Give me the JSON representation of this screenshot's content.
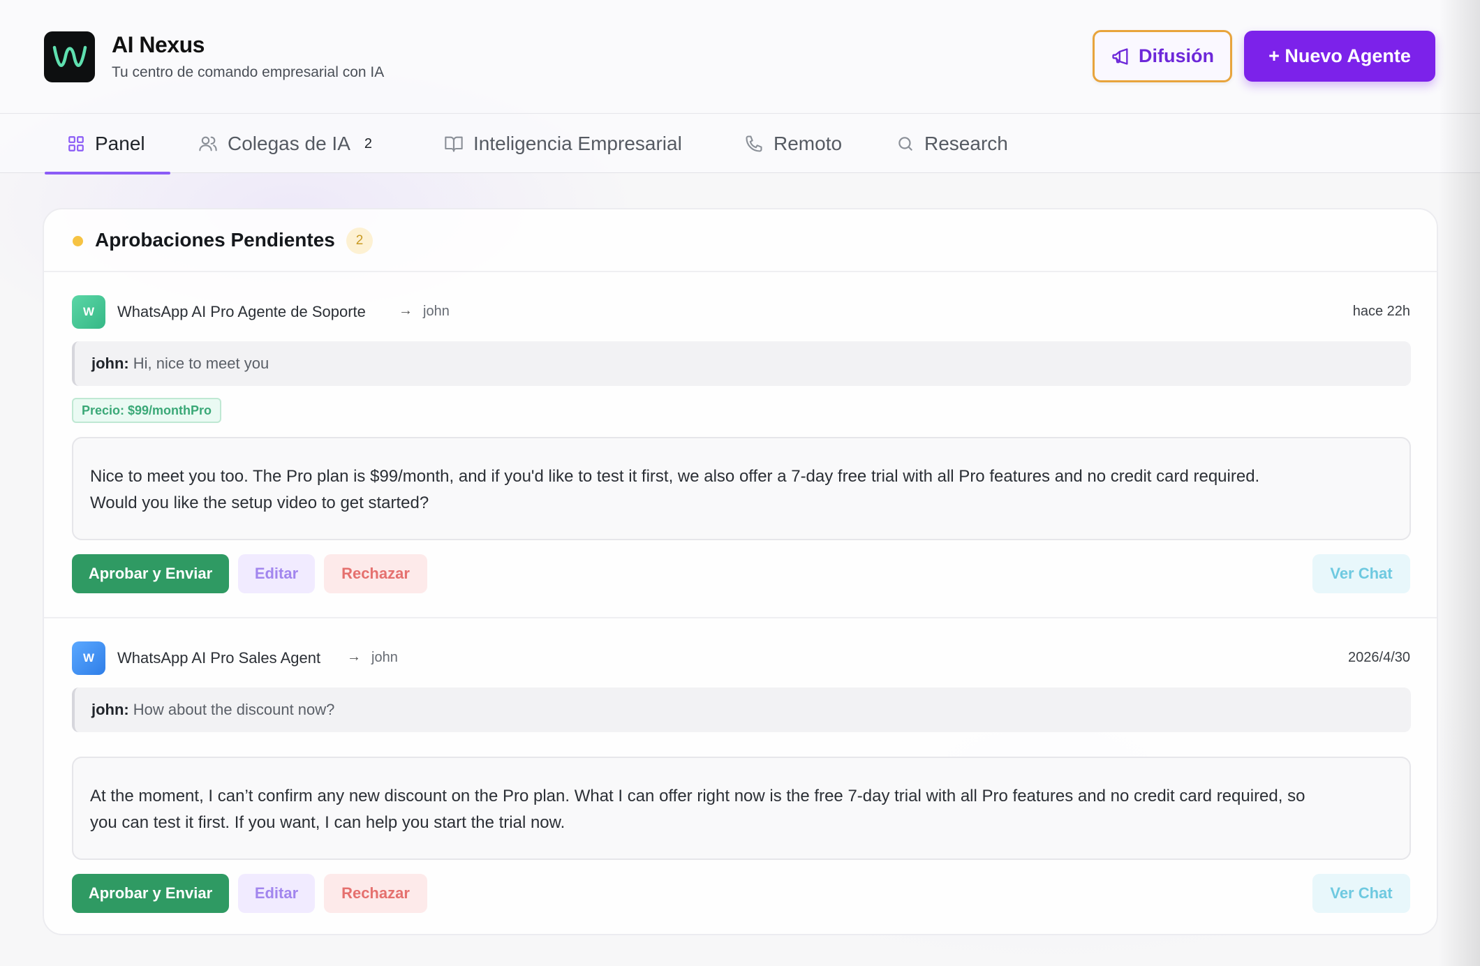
{
  "app": {
    "title": "AI Nexus",
    "subtitle": "Tu centro de comando empresarial con IA",
    "logo_icon": "w-wave-logo"
  },
  "header_actions": {
    "broadcast_label": "Difusión",
    "broadcast_icon": "megaphone-icon",
    "new_agent_label": "+ Nuevo Agente"
  },
  "tabs": [
    {
      "label": "Panel",
      "icon": "grid-icon",
      "active": true
    },
    {
      "label": "Colegas de IA",
      "icon": "users-icon",
      "badge": "2"
    },
    {
      "label": "Inteligencia Empresarial",
      "icon": "book-icon"
    },
    {
      "label": "Remoto",
      "icon": "phone-icon"
    },
    {
      "label": "Research",
      "icon": "search-icon"
    }
  ],
  "pending": {
    "title": "Aprobaciones Pendientes",
    "count": "2",
    "items": [
      {
        "avatar_letter": "W",
        "avatar_color": "#3fc596",
        "agent": "WhatsApp AI Pro Agente de Soporte",
        "arrow": "→",
        "recipient": "john",
        "time": "hace 22h",
        "incoming_sender": "john:",
        "incoming_text": "Hi, nice to meet you",
        "price_tag": "Precio: $99/monthPro",
        "reply_line1": "Nice to meet you too. The Pro plan is $99/month, and if you'd like to test it first, we also offer a 7-day free trial with all Pro features and no credit card required.",
        "reply_line2": "Would you like the setup video to get started?",
        "approve": "Aprobar y Enviar",
        "edit": "Editar",
        "reject": "Rechazar",
        "view_chat": "Ver Chat"
      },
      {
        "avatar_letter": "W",
        "avatar_color": "#3b8df0",
        "agent": "WhatsApp AI Pro Sales Agent",
        "arrow": "→",
        "recipient": "john",
        "time": "2026/4/30",
        "incoming_sender": "john:",
        "incoming_text": "How about the discount now?",
        "reply_line1": "At the moment, I can’t confirm any new discount on the Pro plan. What I can offer right now is the free 7-day trial with all Pro features and no credit card required, so",
        "reply_line2": "you can test it first. If you want, I can help you start the trial now.",
        "approve": "Aprobar y Enviar",
        "edit": "Editar",
        "reject": "Rechazar",
        "view_chat": "Ver Chat"
      }
    ]
  },
  "colors": {
    "accent": "#7c22ea",
    "broadcast_border": "#e8a43c",
    "approve": "#2f9a63",
    "pending_dot": "#f6c343"
  }
}
